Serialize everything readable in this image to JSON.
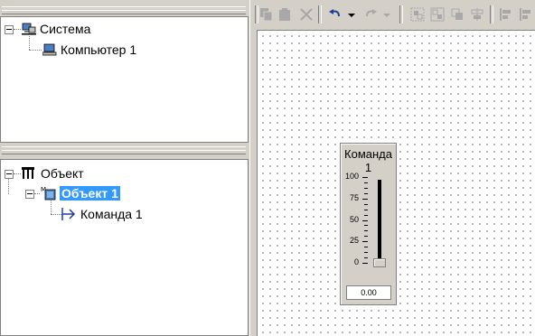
{
  "system_tree": {
    "root_label": "Система",
    "child_label": "Компьютер 1"
  },
  "object_tree": {
    "root_label": "Объект",
    "child_label": "Объект 1",
    "grandchild_label": "Команда 1"
  },
  "toolbar": {
    "icons": [
      "copy-icon",
      "paste-icon",
      "cut-icon",
      "undo-icon",
      "undo-dropdown-icon",
      "redo-icon",
      "redo-dropdown-icon",
      "group-icon",
      "ungroup-icon",
      "bring-front-icon",
      "send-back-icon",
      "align-left-icon",
      "align-center-icon"
    ]
  },
  "widget": {
    "title": "Команда 1",
    "scale": [
      "100",
      "75",
      "50",
      "25",
      "0"
    ],
    "slider_level": 0,
    "value": "0.00"
  }
}
